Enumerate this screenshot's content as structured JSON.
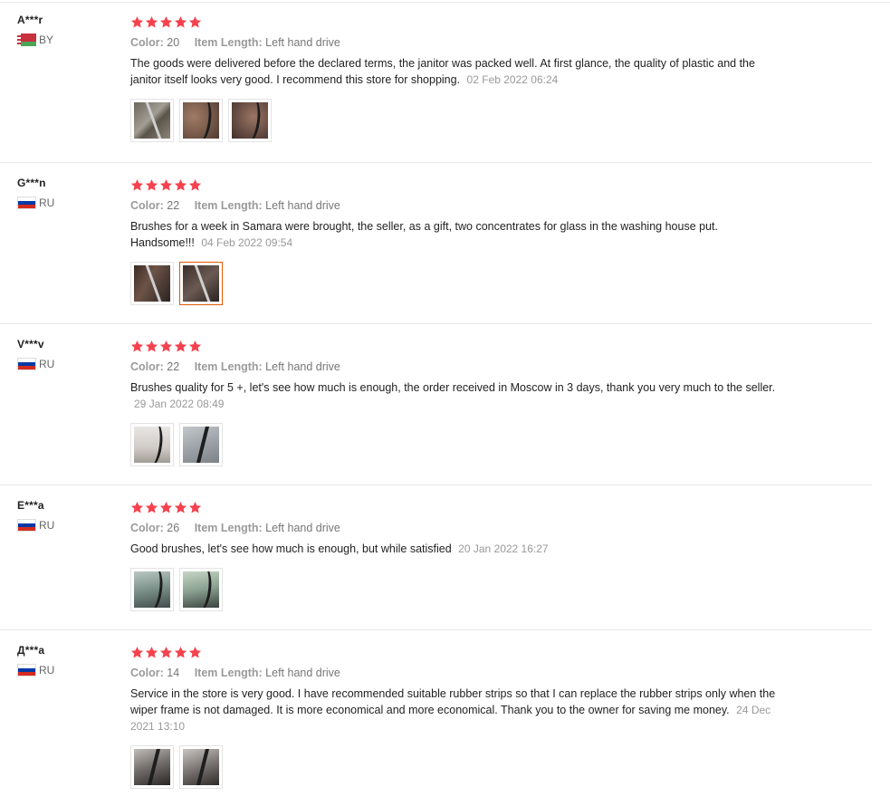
{
  "labels": {
    "color": "Color:",
    "item_length": "Item Length:"
  },
  "star_color": "#f5424e",
  "reviews": [
    {
      "user": "A***r",
      "country": "BY",
      "rating": 5,
      "color": "20",
      "item_length": "Left hand drive",
      "text": "The goods were delivered before the declared terms, the janitor was packed well. At first glance, the quality of plastic and the janitor itself looks very good. I recommend this store for shopping.",
      "date": "02 Feb 2022 06:24",
      "photos": 3
    },
    {
      "user": "G***n",
      "country": "RU",
      "rating": 5,
      "color": "22",
      "item_length": "Left hand drive",
      "text": "Brushes for a week in Samara were brought, the seller, as a gift, two concentrates for glass in the washing house put. Handsome!!!",
      "date": "04 Feb 2022 09:54",
      "photos": 2
    },
    {
      "user": "V***v",
      "country": "RU",
      "rating": 5,
      "color": "22",
      "item_length": "Left hand drive",
      "text": "Brushes quality for 5 +, let's see how much is enough, the order received in Moscow in 3 days, thank you very much to the seller.",
      "date": "29 Jan 2022 08:49",
      "photos": 2
    },
    {
      "user": "E***a",
      "country": "RU",
      "rating": 5,
      "color": "26",
      "item_length": "Left hand drive",
      "text": "Good brushes, let's see how much is enough, but while satisfied",
      "date": "20 Jan 2022 16:27",
      "photos": 2
    },
    {
      "user": "Д***а",
      "country": "RU",
      "rating": 5,
      "color": "14",
      "item_length": "Left hand drive",
      "text": "Service in the store is very good. I have recommended suitable rubber strips so that I can replace the rubber strips only when the wiper frame is not damaged. It is more economical and more economical. Thank you to the owner for saving me money.",
      "date": "24 Dec 2021 13:10",
      "photos": 2
    }
  ]
}
